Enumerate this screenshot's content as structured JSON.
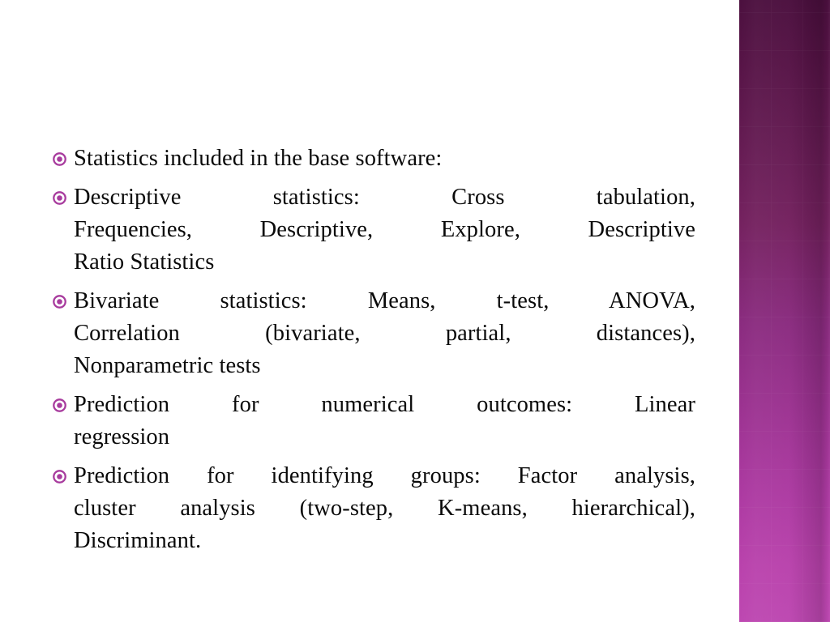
{
  "slide": {
    "background_color": "#ffffff",
    "text_color": "#0a0a0a",
    "bullet_color": "#a83c9e",
    "accent_gradient_top": "#4b0f3e",
    "accent_gradient_bottom": "#bd47b1",
    "bullets": [
      {
        "id": "bullet-1",
        "marker": "ring-dot-bullet-icon",
        "lines": [
          "Statistics included in the base software:"
        ]
      },
      {
        "id": "bullet-2",
        "marker": "ring-dot-bullet-icon",
        "lines": [
          "Descriptive statistics: Cross tabulation,",
          "Frequencies, Descriptive, Explore, Descriptive",
          "Ratio Statistics"
        ]
      },
      {
        "id": "bullet-3",
        "marker": "ring-dot-bullet-icon",
        "lines": [
          "Bivariate statistics: Means, t-test, ANOVA,",
          "Correlation (bivariate, partial, distances),",
          "Nonparametric tests"
        ]
      },
      {
        "id": "bullet-4",
        "marker": "ring-dot-bullet-icon",
        "lines": [
          "Prediction for numerical outcomes: Linear",
          "regression"
        ]
      },
      {
        "id": "bullet-5",
        "marker": "ring-dot-bullet-icon",
        "lines": [
          "Prediction for identifying groups: Factor analysis,",
          "cluster analysis (two-step, K-means, hierarchical),",
          "Discriminant."
        ]
      }
    ]
  }
}
